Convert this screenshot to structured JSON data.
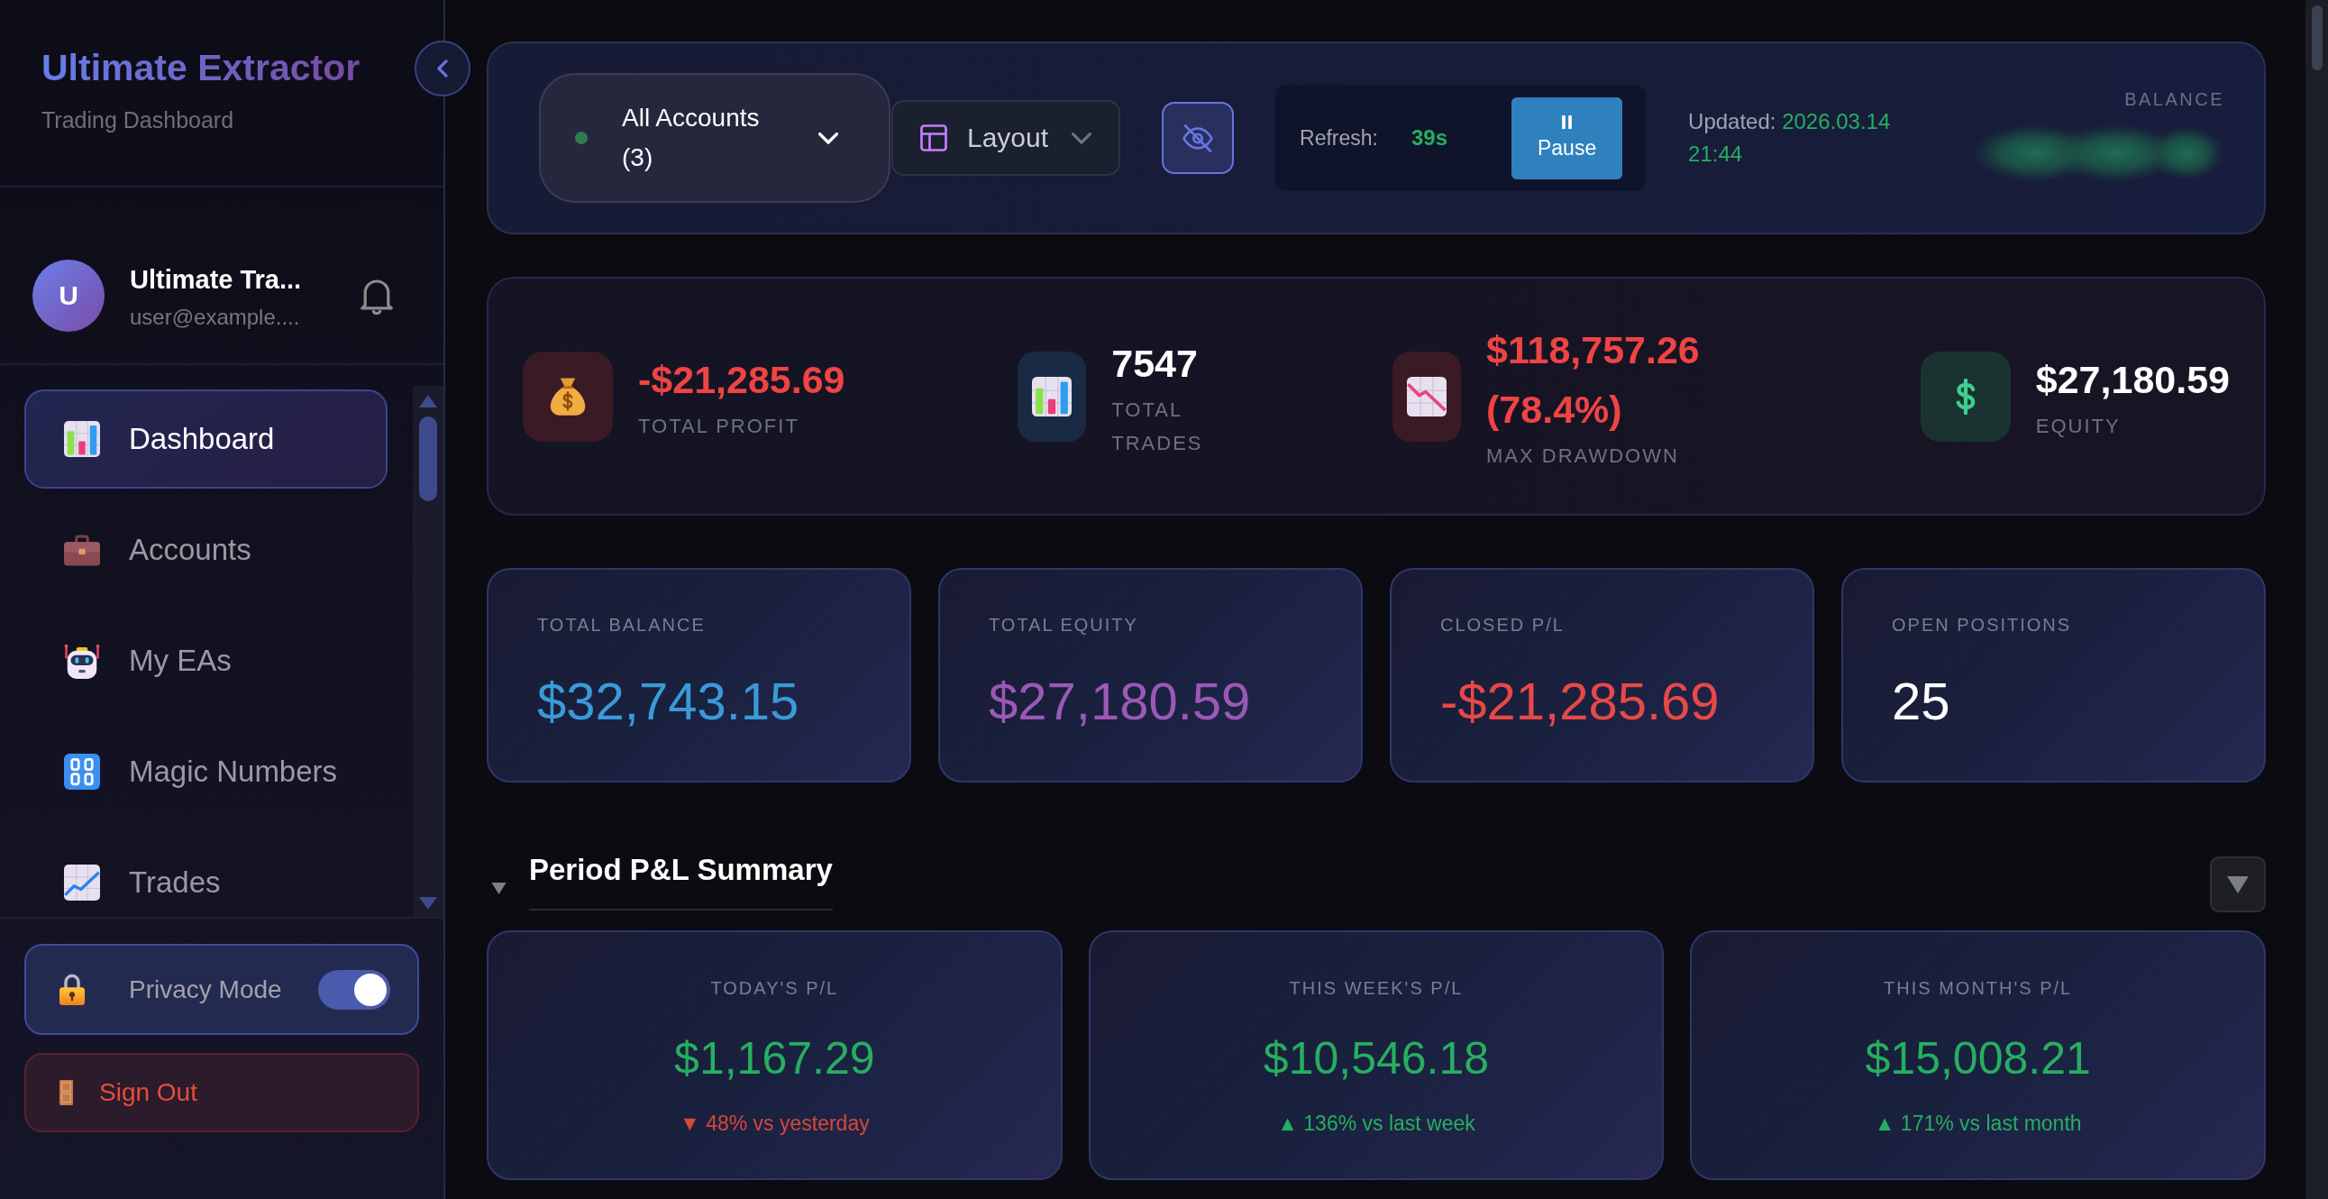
{
  "sidebar": {
    "brand": {
      "title": "Ultimate Extractor",
      "subtitle": "Trading Dashboard"
    },
    "user": {
      "initial": "U",
      "name": "Ultimate Tra...",
      "email": "user@example...."
    },
    "nav": [
      {
        "label": "Dashboard",
        "selected": true
      },
      {
        "label": "Accounts",
        "selected": false
      },
      {
        "label": "My EAs",
        "selected": false
      },
      {
        "label": "Magic Numbers",
        "selected": false
      },
      {
        "label": "Trades",
        "selected": false
      }
    ],
    "privacy_mode": {
      "label": "Privacy Mode",
      "on": true
    },
    "sign_out": {
      "label": "Sign Out"
    }
  },
  "toolbar": {
    "account_selector": {
      "value": "All Accounts (3)"
    },
    "layout_button": {
      "label": "Layout"
    },
    "hide_values_button": {
      "on": true
    },
    "refresh": {
      "label": "Refresh:",
      "countdown": "39s",
      "pause_label": "Pause"
    },
    "updated": {
      "label": "Updated:",
      "value": "2026.03.14 21:44"
    },
    "balance": {
      "label": "BALANCE"
    }
  },
  "stats": [
    {
      "value": "-$21,285.69",
      "label": "TOTAL PROFIT",
      "color": "#ef4444"
    },
    {
      "value": "7547",
      "label": "TOTAL TRADES",
      "color": "#ffffff"
    },
    {
      "value": "$118,757.26 (78.4%)",
      "label": "MAX DRAWDOWN",
      "color": "#ef4444"
    },
    {
      "value": "$27,180.59",
      "label": "EQUITY",
      "color": "#ffffff"
    }
  ],
  "summary_cards": [
    {
      "label": "TOTAL BALANCE",
      "value": "$32,743.15",
      "color": "#3a9ad9"
    },
    {
      "label": "TOTAL EQUITY",
      "value": "$27,180.59",
      "color": "#9b59b6"
    },
    {
      "label": "CLOSED P/L",
      "value": "-$21,285.69",
      "color": "#e84848"
    },
    {
      "label": "OPEN POSITIONS",
      "value": "25",
      "color": "#ffffff"
    }
  ],
  "period_pl": {
    "title": "Period P&L Summary",
    "expanded": true,
    "cards": [
      {
        "label": "TODAY'S P/L",
        "value": "$1,167.29",
        "change": "▼ 48% vs yesterday",
        "color": "#d9463c"
      },
      {
        "label": "THIS WEEK'S P/L",
        "value": "$10,546.18",
        "change": "▲ 136% vs last week",
        "color": "#27ae60"
      },
      {
        "label": "THIS MONTH'S P/L",
        "value": "$15,008.21",
        "change": "▲ 171% vs last month",
        "color": "#27ae60"
      }
    ]
  }
}
